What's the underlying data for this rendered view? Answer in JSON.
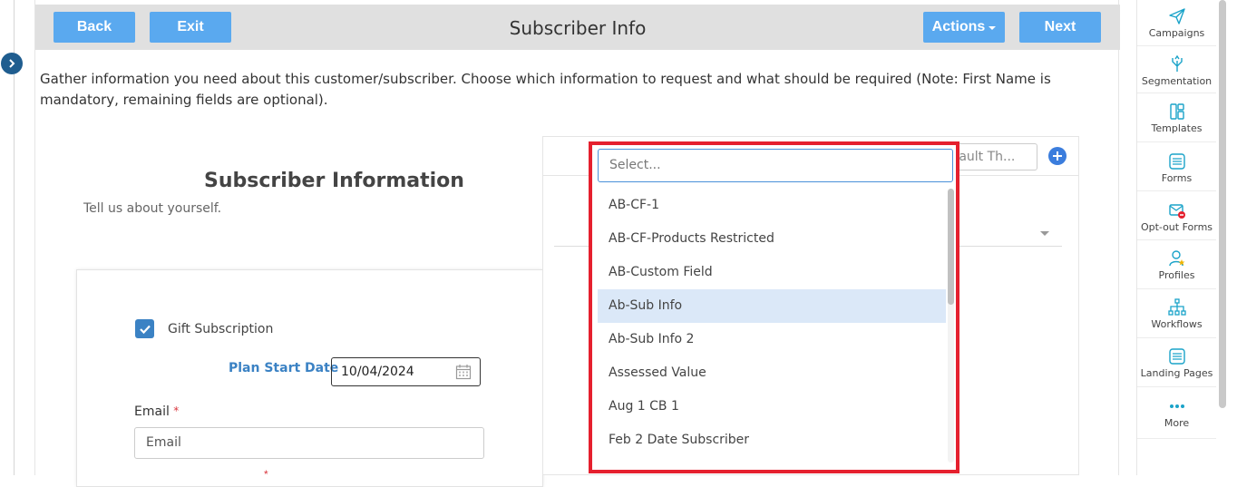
{
  "topbar": {
    "back_label": "Back",
    "exit_label": "Exit",
    "title": "Subscriber Info",
    "actions_label": "Actions",
    "next_label": "Next"
  },
  "description": "Gather information you need about this customer/subscriber. Choose which information to request and what should be required (Note: First Name is mandatory, remaining fields are optional).",
  "preview": {
    "title": "Subscriber Information",
    "subtitle": "Tell us about yourself.",
    "gift_label": "Gift Subscription",
    "gift_checked": true,
    "plan_start_label": "Plan Start Date",
    "plan_start_value": "10/04/2024",
    "email_label": "Email",
    "email_placeholder": "Email",
    "required_mark": "*"
  },
  "right_panel": {
    "default_theme_placeholder": "Default Th..."
  },
  "dropdown": {
    "search_placeholder": "Select...",
    "items": [
      {
        "label": "AB-CF-1"
      },
      {
        "label": "AB-CF-Products Restricted"
      },
      {
        "label": "AB-Custom Field"
      },
      {
        "label": "Ab-Sub Info",
        "highlighted": true
      },
      {
        "label": "Ab-Sub Info 2"
      },
      {
        "label": "Assessed Value"
      },
      {
        "label": "Aug 1 CB 1"
      },
      {
        "label": "Feb 2 Date Subscriber"
      }
    ]
  },
  "sidebar": {
    "items": [
      {
        "label": "Campaigns",
        "icon": "paper-plane-icon"
      },
      {
        "label": "Segmentation",
        "icon": "segmentation-icon"
      },
      {
        "label": "Templates",
        "icon": "templates-icon"
      },
      {
        "label": "Forms",
        "icon": "forms-icon"
      },
      {
        "label": "Opt-out Forms",
        "icon": "opt-out-forms-icon"
      },
      {
        "label": "Profiles",
        "icon": "profiles-icon"
      },
      {
        "label": "Workflows",
        "icon": "workflows-icon"
      },
      {
        "label": "Landing Pages",
        "icon": "landing-pages-icon"
      },
      {
        "label": "More",
        "icon": "more-dots-icon"
      }
    ]
  },
  "colors": {
    "primary_button": "#5aa9ef",
    "dropdown_highlight_border": "#e5202e",
    "sidebar_icon": "#1aa3c9",
    "link_blue": "#3b82c4"
  }
}
